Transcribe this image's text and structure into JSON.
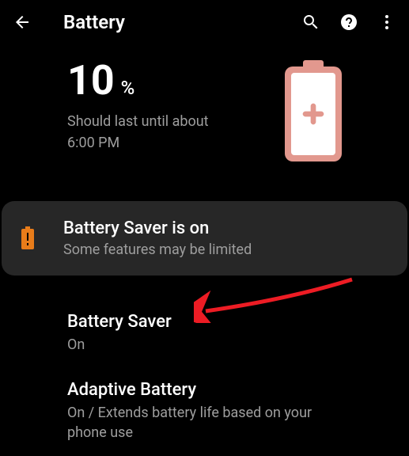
{
  "header": {
    "title": "Battery"
  },
  "battery": {
    "percent": "10",
    "percent_symbol": "%",
    "estimate_line1": "Should last until about",
    "estimate_line2": "6:00 PM"
  },
  "notice": {
    "title": "Battery Saver is on",
    "subtitle": "Some features may be limited"
  },
  "settings": {
    "battery_saver": {
      "title": "Battery Saver",
      "subtitle": "On"
    },
    "adaptive_battery": {
      "title": "Adaptive Battery",
      "subtitle": "On / Extends battery life based on your phone use"
    }
  }
}
